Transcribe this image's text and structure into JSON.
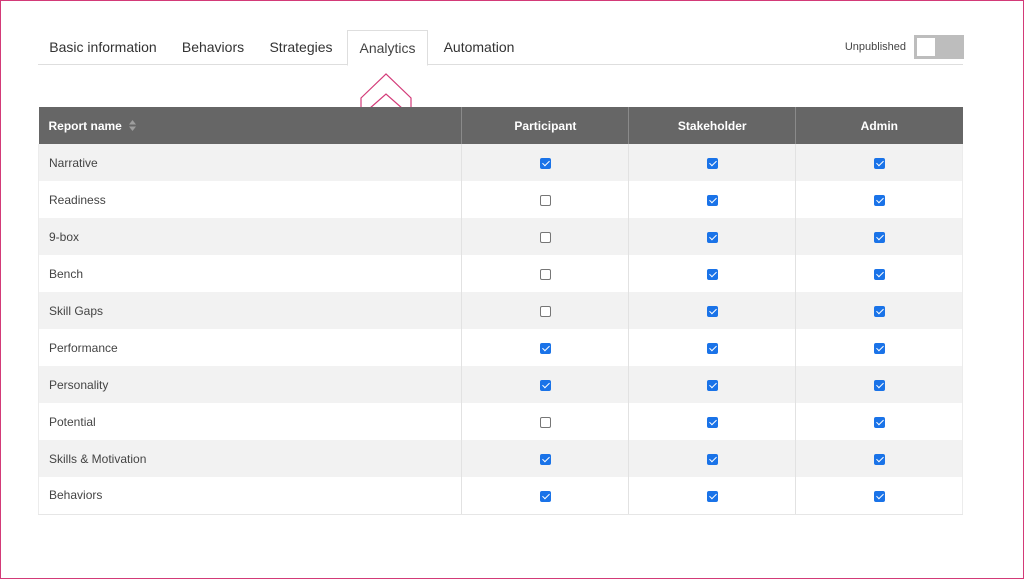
{
  "tabs": [
    {
      "label": "Basic information",
      "active": false
    },
    {
      "label": "Behaviors",
      "active": false
    },
    {
      "label": "Strategies",
      "active": false
    },
    {
      "label": "Analytics",
      "active": true
    },
    {
      "label": "Automation",
      "active": false
    }
  ],
  "publish": {
    "label": "Unpublished",
    "on": false
  },
  "colors": {
    "accent": "#1a73e8",
    "header_bg": "#666666",
    "callout": "#d33a78",
    "frame": "#d33a78"
  },
  "table": {
    "columns": [
      "Report name",
      "Participant",
      "Stakeholder",
      "Admin"
    ],
    "rows": [
      {
        "name": "Narrative",
        "participant": true,
        "stakeholder": true,
        "admin": true
      },
      {
        "name": "Readiness",
        "participant": false,
        "stakeholder": true,
        "admin": true
      },
      {
        "name": "9-box",
        "participant": false,
        "stakeholder": true,
        "admin": true
      },
      {
        "name": "Bench",
        "participant": false,
        "stakeholder": true,
        "admin": true
      },
      {
        "name": "Skill Gaps",
        "participant": false,
        "stakeholder": true,
        "admin": true
      },
      {
        "name": "Performance",
        "participant": true,
        "stakeholder": true,
        "admin": true
      },
      {
        "name": "Personality",
        "participant": true,
        "stakeholder": true,
        "admin": true
      },
      {
        "name": "Potential",
        "participant": false,
        "stakeholder": true,
        "admin": true
      },
      {
        "name": "Skills & Motivation",
        "participant": true,
        "stakeholder": true,
        "admin": true
      },
      {
        "name": "Behaviors",
        "participant": true,
        "stakeholder": true,
        "admin": true
      }
    ]
  }
}
